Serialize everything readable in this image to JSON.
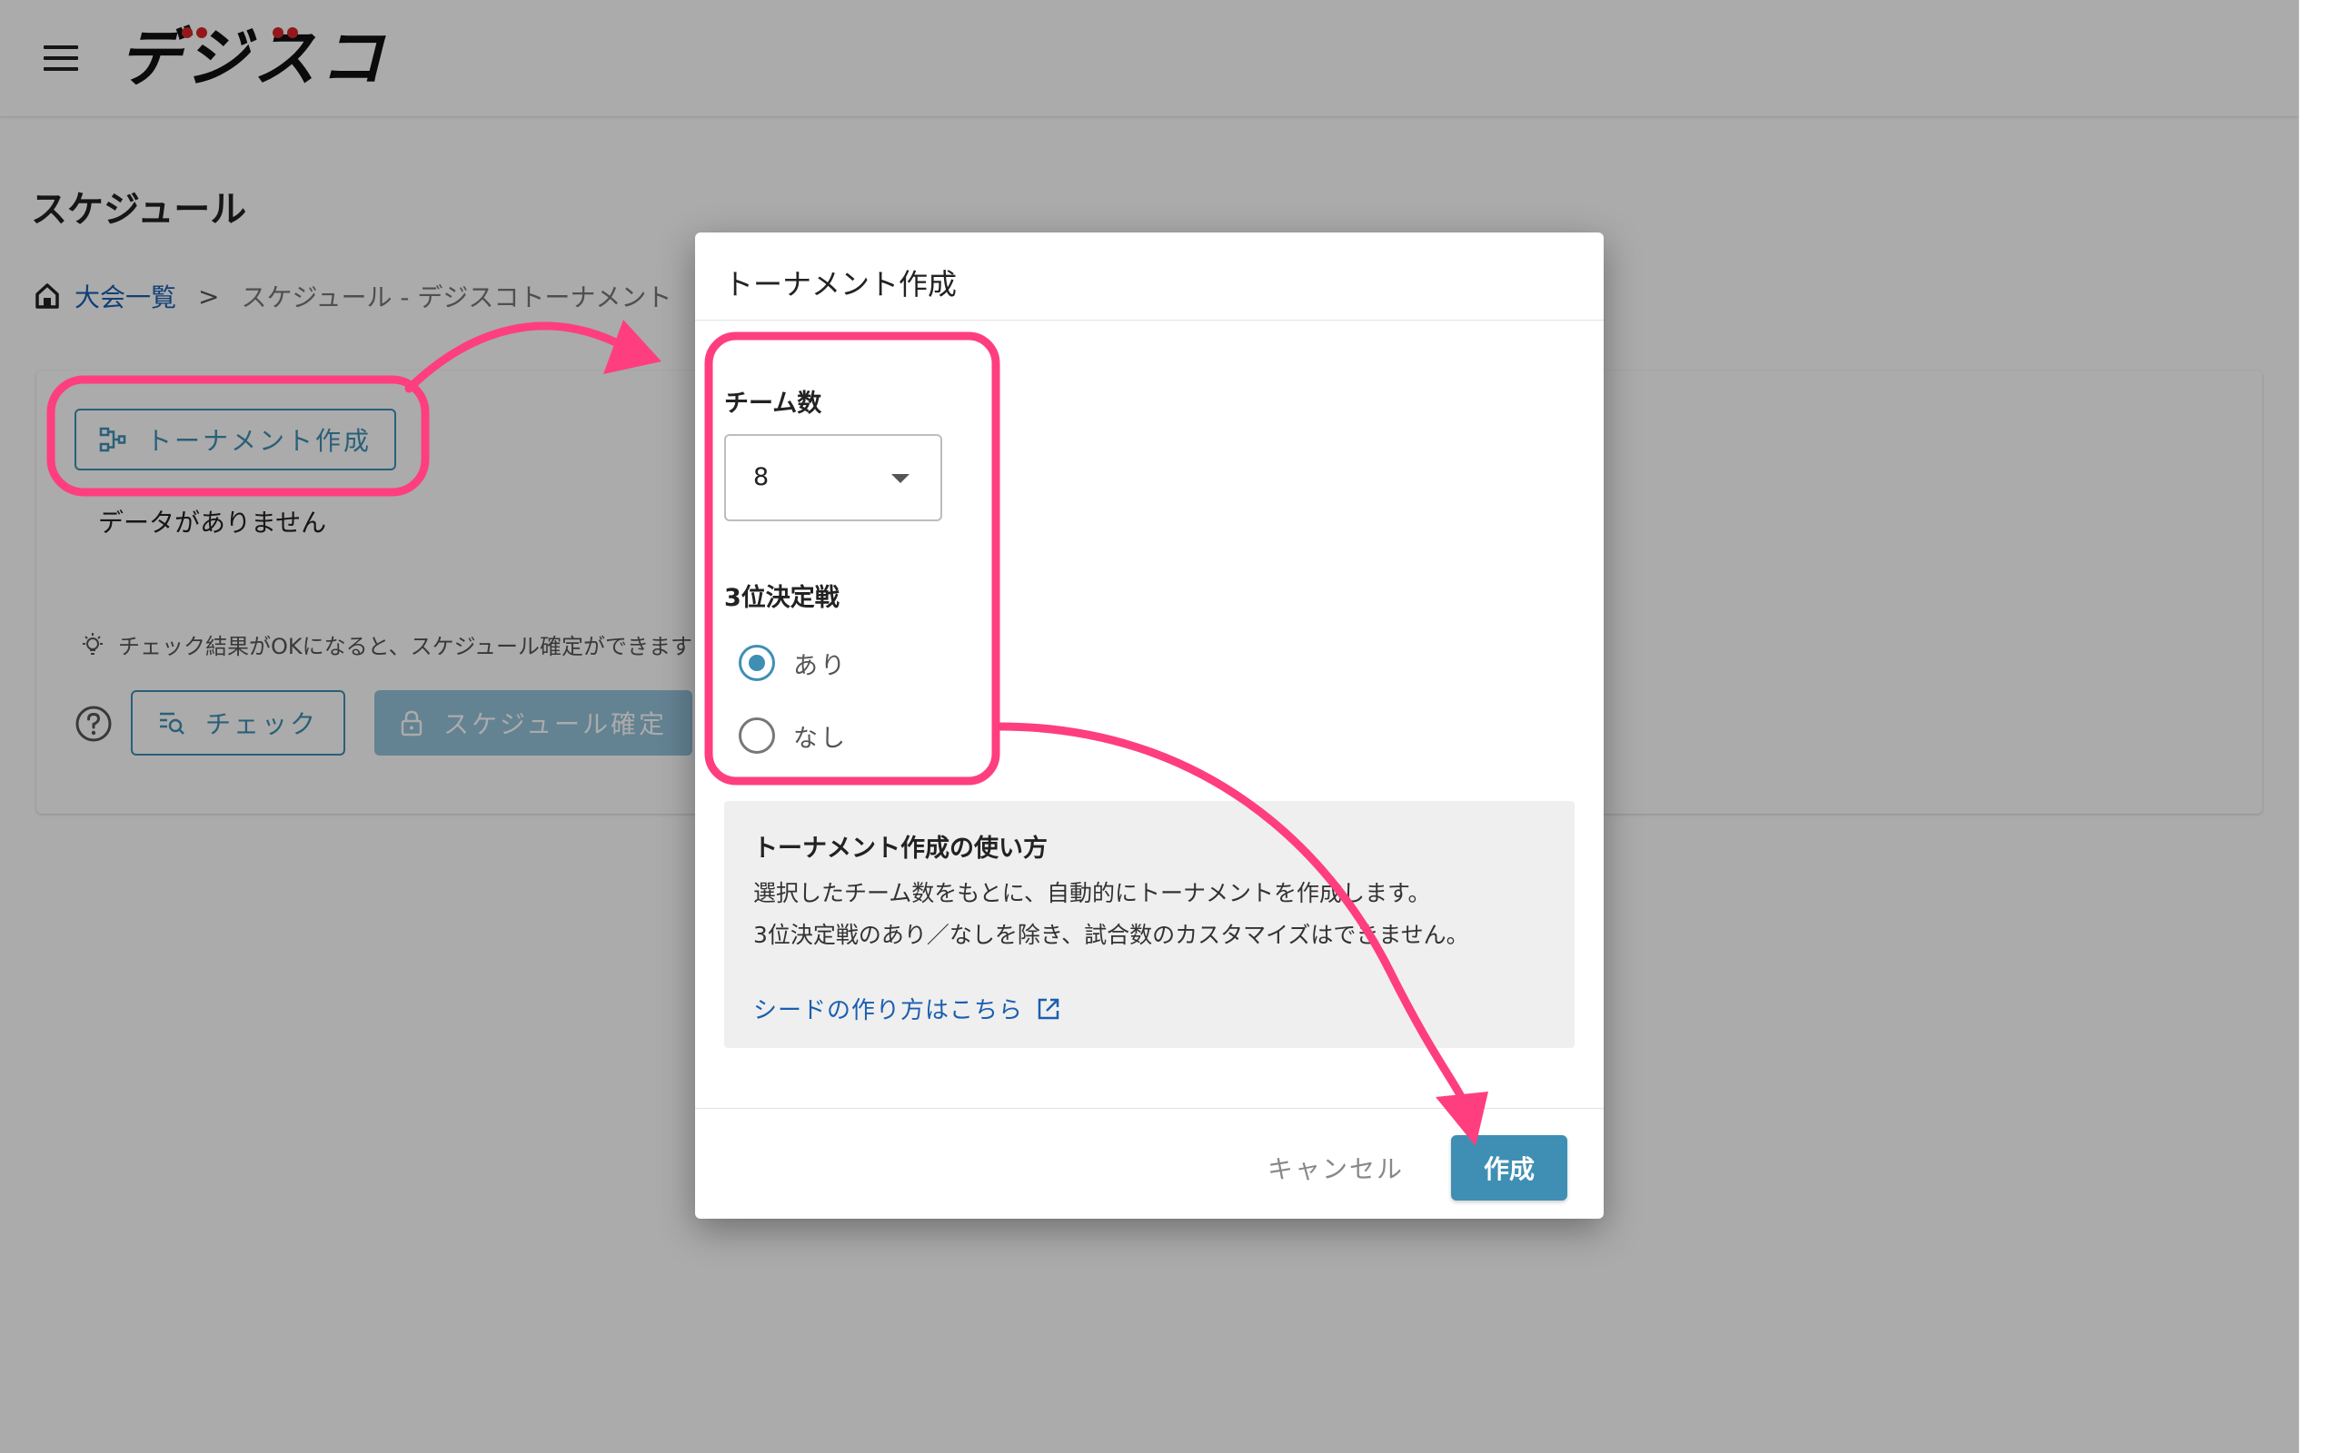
{
  "app": {
    "logo": "デジスコ"
  },
  "page": {
    "title": "スケジュール",
    "breadcrumb": {
      "home_link": "大会一覧",
      "separator": ">",
      "current": "スケジュール - デジスコトーナメント"
    }
  },
  "card": {
    "create_tournament_label": "トーナメント作成",
    "no_data": "データがありません",
    "hint": "チェック結果がOKになると、スケジュール確定ができます",
    "check_label": "チェック",
    "confirm_label": "スケジュール確定"
  },
  "modal": {
    "title": "トーナメント作成",
    "team_count_label": "チーム数",
    "team_count_value": "8",
    "third_place_label": "3位決定戦",
    "third_place_options": [
      {
        "label": "あり",
        "checked": true
      },
      {
        "label": "なし",
        "checked": false
      }
    ],
    "info": {
      "title": "トーナメント作成の使い方",
      "line1": "選択したチーム数をもとに、自動的にトーナメントを作成します。",
      "line2": "3位決定戦のあり／なしを除き、試合数のカスタマイズはできません。",
      "link": "シードの作り方はこちら"
    },
    "cancel_label": "キャンセル",
    "create_label": "作成"
  },
  "colors": {
    "accent": "#3f8fb4",
    "link": "#1a5fb0",
    "annotation": "#ff3e7f",
    "logo_dot": "#d9262b"
  },
  "icons": [
    "menu-icon",
    "home-icon",
    "tournament-bracket-icon",
    "lightbulb-icon",
    "help-circle-icon",
    "search-list-icon",
    "lock-icon",
    "chevron-down-icon",
    "external-link-icon"
  ]
}
